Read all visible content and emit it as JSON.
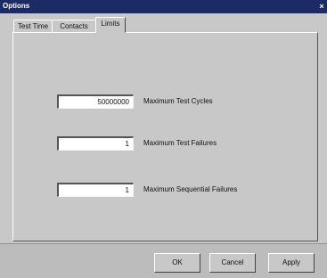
{
  "window": {
    "title": "Options",
    "close_glyph": "×"
  },
  "tabs": [
    {
      "label": "Test Time"
    },
    {
      "label": "Contacts"
    },
    {
      "label": "Limits"
    }
  ],
  "fields": [
    {
      "value": "50000000",
      "label": "Maximum Test Cycles"
    },
    {
      "value": "1",
      "label": "Maximum Test Failures"
    },
    {
      "value": "1",
      "label": "Maximum Sequential Failures"
    }
  ],
  "buttons": {
    "ok": "OK",
    "cancel": "Cancel",
    "apply": "Apply"
  }
}
